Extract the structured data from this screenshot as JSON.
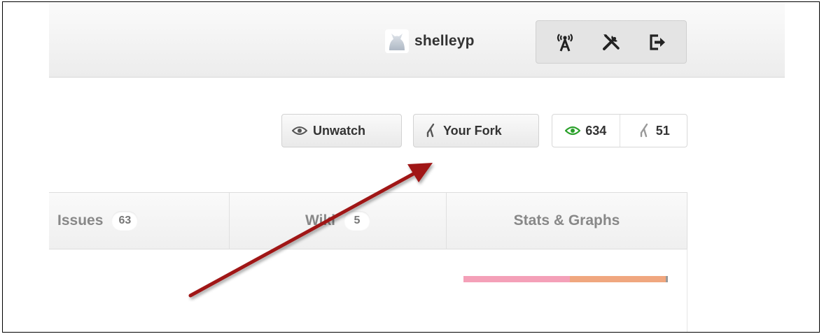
{
  "header": {
    "username": "shelleyp",
    "actions": [
      {
        "icon": "broadcast-icon",
        "label": "Broadcast"
      },
      {
        "icon": "tools-icon",
        "label": "Account settings"
      },
      {
        "icon": "sign-out-icon",
        "label": "Sign out"
      }
    ]
  },
  "repo_actions": {
    "unwatch_label": "Unwatch",
    "fork_label": "Your Fork",
    "watchers_count": "634",
    "forks_count": "51"
  },
  "tabs": [
    {
      "label": "Issues",
      "count": "63"
    },
    {
      "label": "Wiki",
      "count": "5"
    },
    {
      "label": "Stats & Graphs"
    }
  ],
  "language_bar": [
    {
      "color": "#f4a0b8",
      "share": 0.52
    },
    {
      "color": "#f0a77f",
      "share": 0.47
    },
    {
      "color": "#9a9a9a",
      "share": 0.01
    }
  ],
  "annotation": {
    "type": "arrow",
    "color": "#a01818",
    "points_to": "fork-button"
  },
  "colors": {
    "watch_accent": "#2aa02a",
    "fork_icon_gray": "#999999"
  }
}
